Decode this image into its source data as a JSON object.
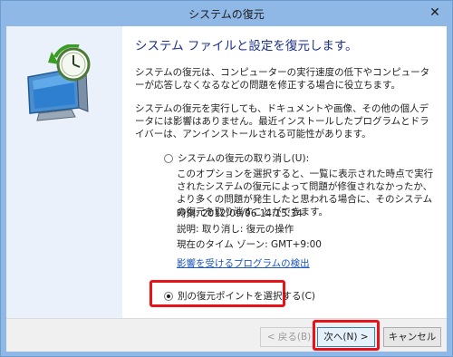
{
  "window": {
    "title": "システムの復元",
    "close_glyph": "✕"
  },
  "main": {
    "heading": "システム ファイルと設定を復元します。",
    "para1": "システムの復元は、コンピューターの実行速度の低下やコンピューターが応答しなくなるなどの問題を修正する場合に役立ちます。",
    "para2": "システムの復元を実行しても、ドキュメントや画像、その他の個人データには影響はありません。最近インストールしたプログラムとドライバーは、アンインストールされる可能性があります。",
    "undo_option": {
      "label": "システムの復元の取り消し(U):",
      "selected": false,
      "description": "このオプションを選択すると、一覧に表示された時点で実行されたシステムの復元によって問題が修復されなかったか、より多くの問題が発生したと思われる場合に、そのシステムの復元を取り消すことができます。",
      "time": "時刻: 2012/09/06 14:15:34",
      "desc_line": "説明: 取り消し: 復元の操作",
      "timezone": "現在のタイム ゾーン: GMT+9:00",
      "link": "影響を受けるプログラムの検出"
    },
    "other_option": {
      "label": "別の復元ポイントを選択する(C)",
      "selected": true
    }
  },
  "footer": {
    "back_label": "< 戻る(B)",
    "next_label": "次へ(N) >",
    "cancel_label": "キャンセル"
  },
  "colors": {
    "titlebar": "#8fb8e6",
    "heading": "#1e3287",
    "link": "#1e57b8",
    "highlight": "#e8131a"
  },
  "icons": [
    "system-restore-icon",
    "close-icon"
  ]
}
